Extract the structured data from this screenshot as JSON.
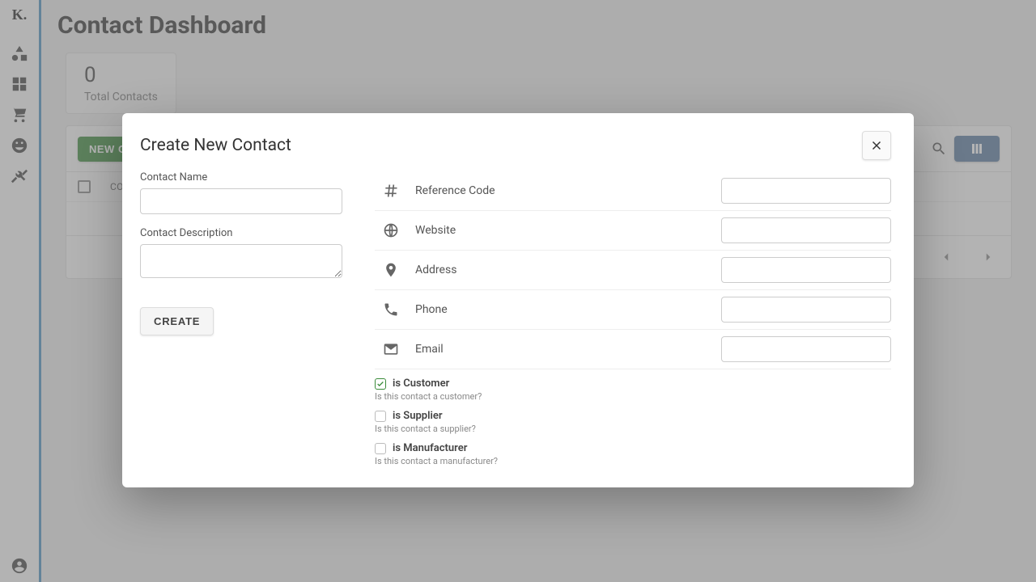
{
  "app": {
    "logo": "K."
  },
  "page": {
    "title": "Contact Dashboard",
    "counter": {
      "value": "0",
      "label": "Total Contacts"
    }
  },
  "toolbar": {
    "new_contact": "NEW CONTACT"
  },
  "table": {
    "col_contact": "CONTACT NAME"
  },
  "modal": {
    "title": "Create New Contact",
    "fields": {
      "name_label": "Contact Name",
      "desc_label": "Contact Description"
    },
    "create_btn": "CREATE",
    "right_fields": {
      "reference": "Reference Code",
      "website": "Website",
      "address": "Address",
      "phone": "Phone",
      "email": "Email"
    },
    "flags": {
      "customer": {
        "label": "is Customer",
        "sub": "Is this contact a customer?"
      },
      "supplier": {
        "label": "is Supplier",
        "sub": "Is this contact a supplier?"
      },
      "manufacturer": {
        "label": "is Manufacturer",
        "sub": "Is this contact a manufacturer?"
      }
    }
  }
}
